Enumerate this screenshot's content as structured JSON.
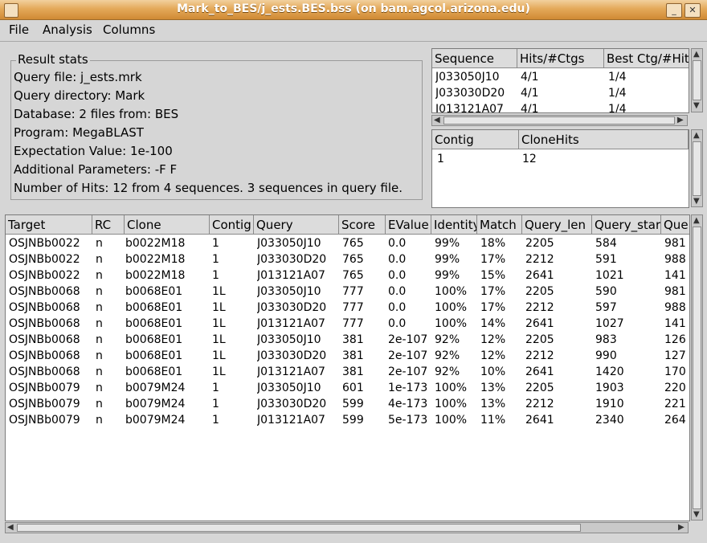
{
  "window": {
    "title": "Mark_to_BES/j_ests.BES.bss (on bam.agcol.arizona.edu)",
    "minimize": "_",
    "close": "✕"
  },
  "menu": [
    "File",
    "Analysis",
    "Columns"
  ],
  "stats": {
    "group_title": "Result stats",
    "lines": [
      "Query file: j_ests.mrk",
      "Query directory: Mark",
      "Database: 2 files from: BES",
      "Program: MegaBLAST",
      "Expectation Value: 1e-100",
      "Additional Parameters: -F F",
      "Number of Hits: 12 from 4 sequences.  3 sequences in query file."
    ]
  },
  "seq_table": {
    "headers": [
      "Sequence",
      "Hits/#Ctgs",
      "Best Ctg/#Hits"
    ],
    "rows": [
      [
        "J033050J10",
        "4/1",
        "1/4"
      ],
      [
        "J033030D20",
        "4/1",
        "1/4"
      ],
      [
        "J013121A07",
        "4/1",
        "1/4"
      ]
    ]
  },
  "contig_table": {
    "headers": [
      "Contig",
      "CloneHits"
    ],
    "rows": [
      [
        "1",
        "12"
      ]
    ]
  },
  "hits_table": {
    "headers": [
      "Target",
      "RC",
      "Clone",
      "Contig",
      "Query",
      "Score",
      "EValue",
      "Identity",
      "Match",
      "Query_len",
      "Query_start",
      "Que"
    ],
    "rows": [
      [
        "OSJNBb0022",
        "n",
        "b0022M18",
        "1",
        "J033050J10",
        "765",
        "0.0",
        "99%",
        "18%",
        "2205",
        "584",
        "981"
      ],
      [
        "OSJNBb0022",
        "n",
        "b0022M18",
        "1",
        "J033030D20",
        "765",
        "0.0",
        "99%",
        "17%",
        "2212",
        "591",
        "988"
      ],
      [
        "OSJNBb0022",
        "n",
        "b0022M18",
        "1",
        "J013121A07",
        "765",
        "0.0",
        "99%",
        "15%",
        "2641",
        "1021",
        "141"
      ],
      [
        "OSJNBb0068",
        "n",
        "b0068E01",
        "1L",
        "J033050J10",
        "777",
        "0.0",
        "100%",
        "17%",
        "2205",
        "590",
        "981"
      ],
      [
        "OSJNBb0068",
        "n",
        "b0068E01",
        "1L",
        "J033030D20",
        "777",
        "0.0",
        "100%",
        "17%",
        "2212",
        "597",
        "988"
      ],
      [
        "OSJNBb0068",
        "n",
        "b0068E01",
        "1L",
        "J013121A07",
        "777",
        "0.0",
        "100%",
        "14%",
        "2641",
        "1027",
        "141"
      ],
      [
        "OSJNBb0068",
        "n",
        "b0068E01",
        "1L",
        "J033050J10",
        "381",
        "2e-107",
        "92%",
        "12%",
        "2205",
        "983",
        "126"
      ],
      [
        "OSJNBb0068",
        "n",
        "b0068E01",
        "1L",
        "J033030D20",
        "381",
        "2e-107",
        "92%",
        "12%",
        "2212",
        "990",
        "127"
      ],
      [
        "OSJNBb0068",
        "n",
        "b0068E01",
        "1L",
        "J013121A07",
        "381",
        "2e-107",
        "92%",
        "10%",
        "2641",
        "1420",
        "170"
      ],
      [
        "OSJNBb0079",
        "n",
        "b0079M24",
        "1",
        "J033050J10",
        "601",
        "1e-173",
        "100%",
        "13%",
        "2205",
        "1903",
        "220"
      ],
      [
        "OSJNBb0079",
        "n",
        "b0079M24",
        "1",
        "J033030D20",
        "599",
        "4e-173",
        "100%",
        "13%",
        "2212",
        "1910",
        "221"
      ],
      [
        "OSJNBb0079",
        "n",
        "b0079M24",
        "1",
        "J013121A07",
        "599",
        "5e-173",
        "100%",
        "11%",
        "2641",
        "2340",
        "264"
      ]
    ]
  }
}
